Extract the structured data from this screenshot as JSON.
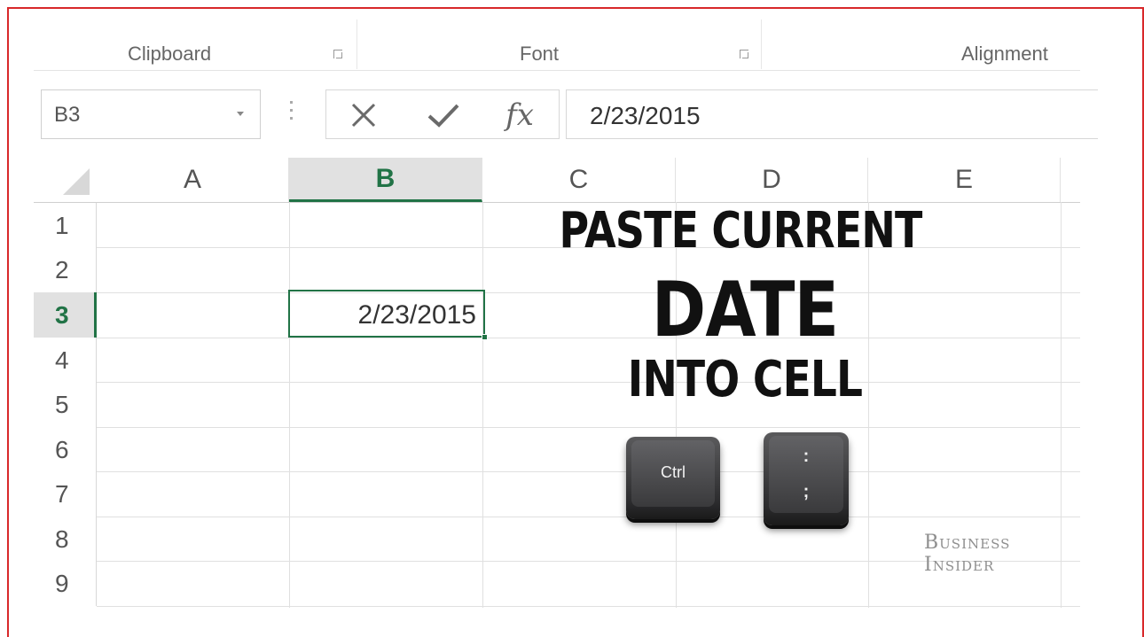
{
  "ribbon": {
    "groups": [
      {
        "label": "Clipboard"
      },
      {
        "label": "Font"
      },
      {
        "label": "Alignment"
      }
    ]
  },
  "formula_bar": {
    "name_box": "B3",
    "cancel_icon": "close-icon",
    "enter_icon": "check-icon",
    "fx_label": "fx",
    "formula_value": "2/23/2015"
  },
  "sheet": {
    "columns": [
      "A",
      "B",
      "C",
      "D",
      "E"
    ],
    "rows": [
      "1",
      "2",
      "3",
      "4",
      "5",
      "6",
      "7",
      "8",
      "9"
    ],
    "selected_column": "B",
    "selected_row": "3",
    "active_cell": "B3",
    "active_cell_value": "2/23/2015"
  },
  "overlay": {
    "line1": "PASTE CURRENT",
    "line2": "DATE",
    "line3": "INTO CELL"
  },
  "keys": {
    "ctrl_label": "Ctrl",
    "colon_top": ":",
    "colon_bottom": ";"
  },
  "brand": {
    "line1": "Business",
    "line2": "Insider"
  },
  "colors": {
    "accent_green": "#217346",
    "frame_red": "#d8282a"
  }
}
